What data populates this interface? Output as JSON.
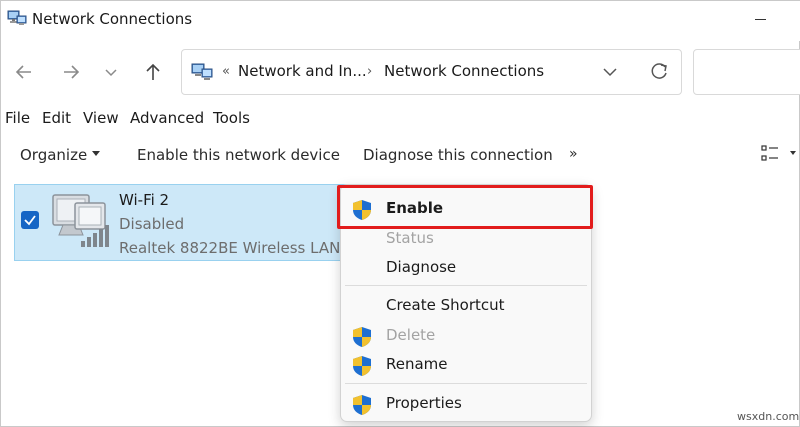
{
  "window": {
    "title": "Network Connections"
  },
  "address": {
    "overflow": "«",
    "crumbs": [
      "Network and In...",
      "Network Connections"
    ],
    "separator": "›"
  },
  "menubar": [
    "File",
    "Edit",
    "View",
    "Advanced",
    "Tools"
  ],
  "commandbar": {
    "organize": "Organize",
    "enable": "Enable this network device",
    "diagnose": "Diagnose this connection",
    "more": "»"
  },
  "item": {
    "name": "Wi-Fi 2",
    "status": "Disabled",
    "device": "Realtek 8822BE Wireless LAN ..."
  },
  "context_menu": {
    "enable": "Enable",
    "status": "Status",
    "diagnose": "Diagnose",
    "create_shortcut": "Create Shortcut",
    "delete": "Delete",
    "rename": "Rename",
    "properties": "Properties"
  },
  "colors": {
    "highlight_border": "#e21c1c",
    "selection_bg": "#cde8f8",
    "checkbox": "#1666c5"
  },
  "watermark": "wsxdn.com"
}
